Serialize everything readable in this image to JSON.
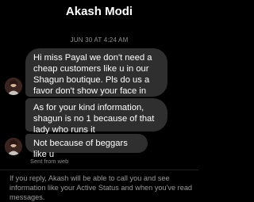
{
  "header": {
    "title": "Akash Modi"
  },
  "conversation": {
    "timestamp": "JUN 30 AT 4:24 AM",
    "messages": [
      {
        "text": "Hi miss Payal we don't need a cheap customers like u in our Shagun boutique. Pls do us a favor don't show your face in our store"
      },
      {
        "text": "As for your kind information, shagun is no 1 because of that lady who runs it"
      },
      {
        "text": "Not because of beggars like u"
      }
    ],
    "sent_status": "Sent from web"
  },
  "footer": {
    "notice": "If you reply, Akash will be able to call you and see information like your Active Status and when you've read messages."
  },
  "colors": {
    "background": "#000000",
    "bubble": "#2f2f2f",
    "muted_text": "#8f8f8f"
  }
}
